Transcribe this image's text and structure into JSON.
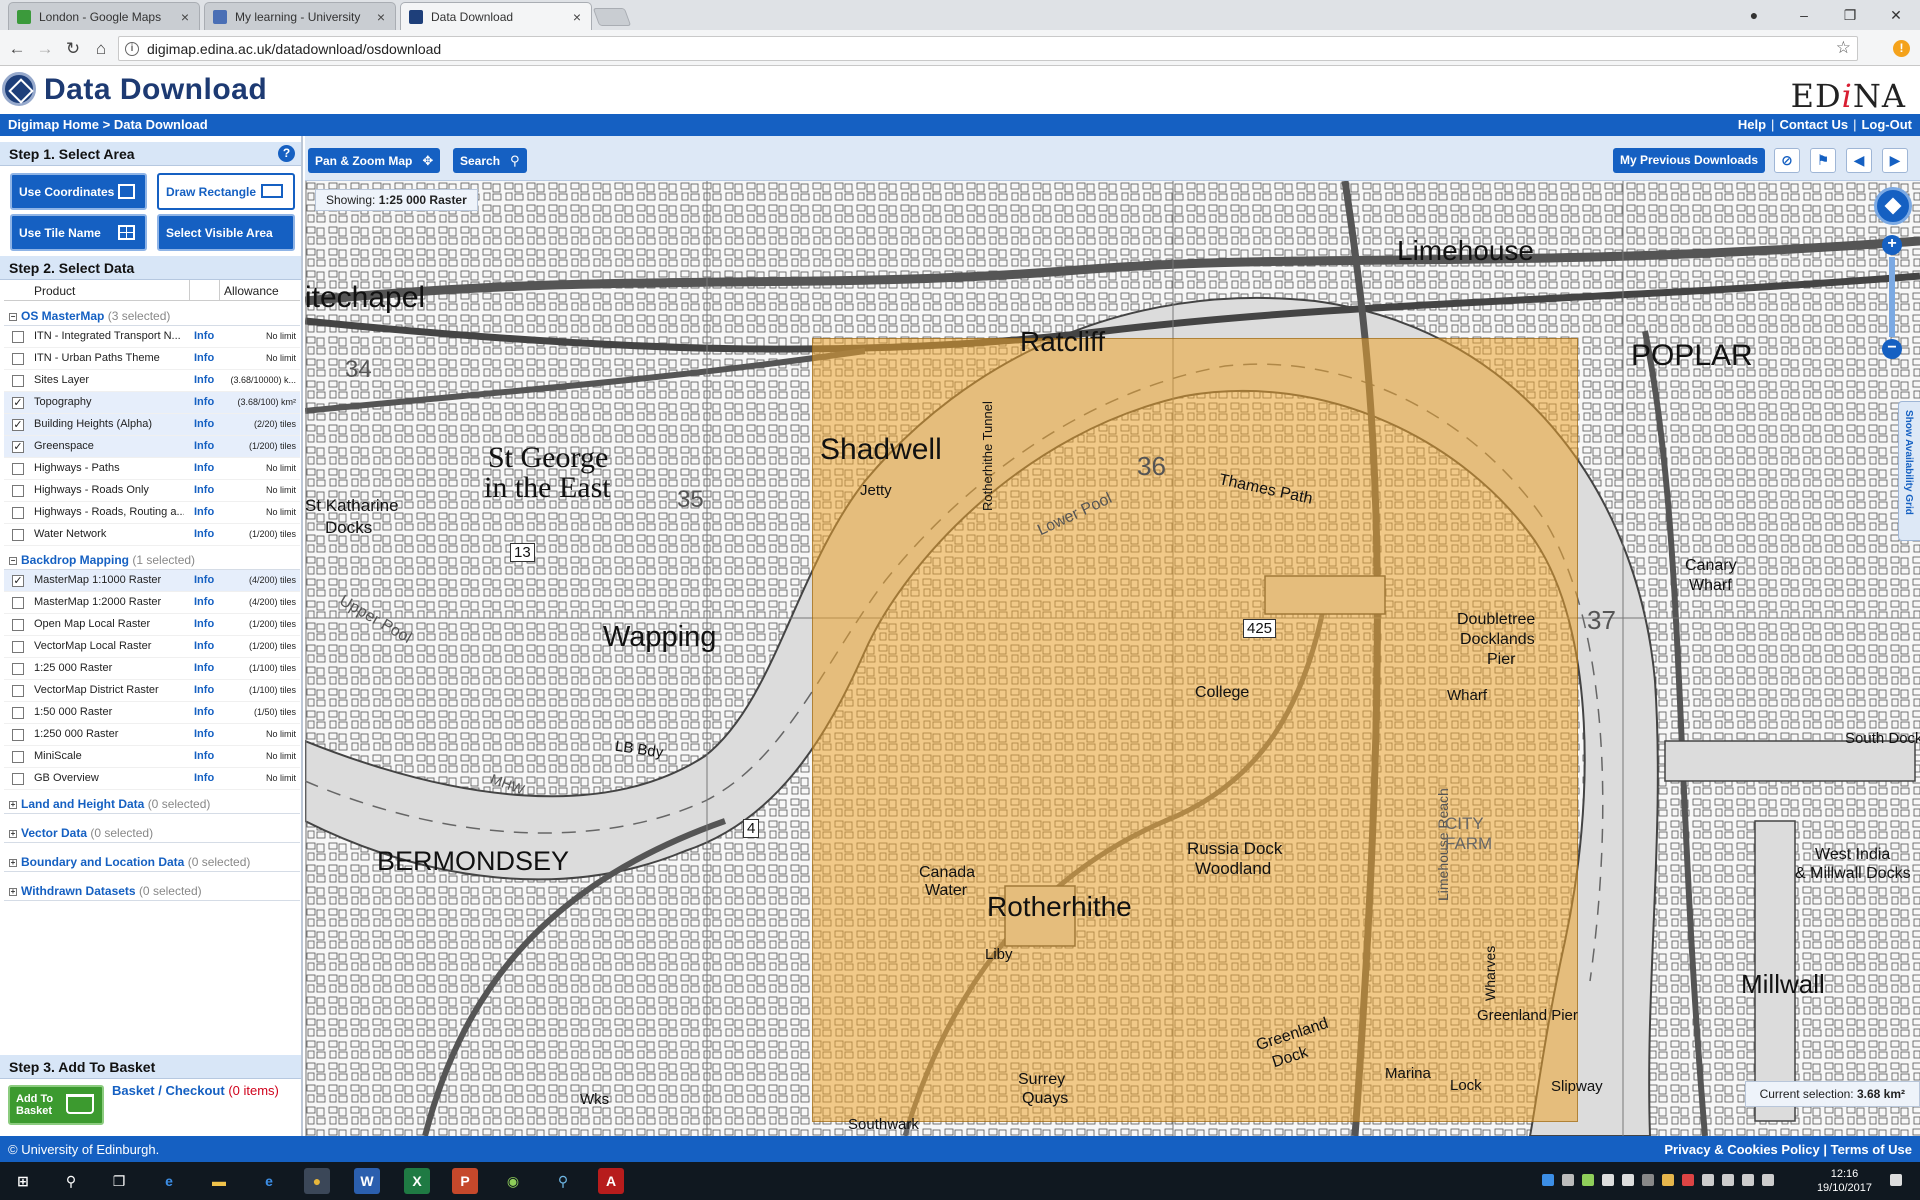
{
  "browser": {
    "tabs": [
      {
        "title": "London - Google Maps",
        "favicon_color": "#3b9a3b"
      },
      {
        "title": "My learning - University",
        "favicon_color": "#4a6fb5"
      },
      {
        "title": "Data Download",
        "favicon_color": "#1e3f7a"
      }
    ],
    "active_tab": 2,
    "url": "digimap.edina.ac.uk/datadownload/osdownload"
  },
  "header": {
    "title": "Data Download",
    "edina_prefix": "ED",
    "edina_i": "i",
    "edina_suffix": "NA"
  },
  "breadcrumb": "Digimap Home > Data Download",
  "topnav": {
    "help": "Help",
    "contact": "Contact Us",
    "logout": "Log-Out",
    "sep": "|"
  },
  "step1": {
    "title": "Step 1. Select Area",
    "help": "?",
    "buttons": {
      "use_coordinates": "Use Coordinates",
      "draw_rectangle": "Draw Rectangle",
      "use_tile_name": "Use Tile Name",
      "select_visible_area": "Select Visible Area"
    },
    "selected_button": "draw_rectangle"
  },
  "step2": {
    "title": "Step 2. Select Data",
    "col_product": "Product",
    "col_allowance": "Allowance",
    "info_label": "Info",
    "groups": [
      {
        "name": "OS MasterMap",
        "count": "(3 selected)",
        "expanded": true,
        "products": [
          {
            "name": "ITN - Integrated Transport N...",
            "allowance": "No limit",
            "checked": false
          },
          {
            "name": "ITN - Urban Paths Theme",
            "allowance": "No limit",
            "checked": false
          },
          {
            "name": "Sites Layer",
            "allowance": "(3.68/10000) k...",
            "checked": false
          },
          {
            "name": "Topography",
            "allowance": "(3.68/100) km²",
            "checked": true
          },
          {
            "name": "Building Heights (Alpha)",
            "allowance": "(2/20) tiles",
            "checked": true
          },
          {
            "name": "Greenspace",
            "allowance": "(1/200) tiles",
            "checked": true
          },
          {
            "name": "Highways - Paths",
            "allowance": "No limit",
            "checked": false
          },
          {
            "name": "Highways - Roads Only",
            "allowance": "No limit",
            "checked": false
          },
          {
            "name": "Highways - Roads, Routing a...",
            "allowance": "No limit",
            "checked": false
          },
          {
            "name": "Water Network",
            "allowance": "(1/200) tiles",
            "checked": false
          }
        ]
      },
      {
        "name": "Backdrop Mapping",
        "count": "(1 selected)",
        "expanded": true,
        "products": [
          {
            "name": "MasterMap 1:1000 Raster",
            "allowance": "(4/200) tiles",
            "checked": true
          },
          {
            "name": "MasterMap 1:2000 Raster",
            "allowance": "(4/200) tiles",
            "checked": false
          },
          {
            "name": "Open Map Local Raster",
            "allowance": "(1/200) tiles",
            "checked": false
          },
          {
            "name": "VectorMap Local Raster",
            "allowance": "(1/200) tiles",
            "checked": false
          },
          {
            "name": "1:25 000 Raster",
            "allowance": "(1/100) tiles",
            "checked": false
          },
          {
            "name": "VectorMap District Raster",
            "allowance": "(1/100) tiles",
            "checked": false
          },
          {
            "name": "1:50 000 Raster",
            "allowance": "(1/50) tiles",
            "checked": false
          },
          {
            "name": "1:250 000 Raster",
            "allowance": "No limit",
            "checked": false
          },
          {
            "name": "MiniScale",
            "allowance": "No limit",
            "checked": false
          },
          {
            "name": "GB Overview",
            "allowance": "No limit",
            "checked": false
          }
        ]
      },
      {
        "name": "Land and Height Data",
        "count": "(0 selected)",
        "expanded": false,
        "products": []
      },
      {
        "name": "Vector Data",
        "count": "(0 selected)",
        "expanded": false,
        "products": []
      },
      {
        "name": "Boundary and Location Data",
        "count": "(0 selected)",
        "expanded": false,
        "products": []
      },
      {
        "name": "Withdrawn Datasets",
        "count": "(0 selected)",
        "expanded": false,
        "products": []
      }
    ]
  },
  "step3": {
    "title": "Step 3. Add To Basket",
    "add_label_1": "Add To",
    "add_label_2": "Basket",
    "basket_link": "Basket / Checkout",
    "basket_items": "(0 items)"
  },
  "toolbar": {
    "pan_zoom": "Pan & Zoom Map",
    "search": "Search",
    "previous_downloads": "My Previous Downloads"
  },
  "map": {
    "showing_label": "Showing:",
    "showing_value": "1:25 000 Raster",
    "current_selection_label": "Current selection:",
    "current_selection_value": "3.68 km²",
    "availability_tab": "Show Availability Grid",
    "selection_color": "#eca42d",
    "place_labels": [
      "itechapel",
      "Ratcliff",
      "Limehouse",
      "POPLAR",
      "Shadwell",
      "St George",
      "in the East",
      "St Katharine",
      "Docks",
      "Wapping",
      "Rotherhithe",
      "BERMONDSEY",
      "Millwall",
      "Canary",
      "Wharf",
      "Russia Dock",
      "Woodland",
      "Canada",
      "Water",
      "College",
      "Greenland",
      "Dock",
      "Surrey",
      "Quays",
      "Thames Path",
      "Lower Pool",
      "Upper Pool",
      "Limehouse Reach",
      "CITY",
      "FARM",
      "Doubletree",
      "Docklands",
      "Pier",
      "West India",
      "& Millwall Docks",
      "South Dock",
      "LB Bdy",
      "MHW",
      "Jetty",
      "Wharf",
      "Slipway",
      "Lock",
      "Marina",
      "Liby",
      "Southwark",
      "Wks",
      "34",
      "35",
      "36",
      "37",
      "425",
      "13",
      "4",
      "Rotherhithe Tunnel",
      "Wharves",
      "Greenland Pier"
    ]
  },
  "footer": {
    "copyright": "© University of Edinburgh.",
    "privacy": "Privacy & Cookies Policy",
    "terms": "Terms of Use",
    "sep": "|"
  },
  "taskbar": {
    "time": "12:16",
    "date": "19/10/2017"
  },
  "colors": {
    "brand_blue": "#1560c2",
    "panel_header": "#d8e6f7",
    "basket_green": "#3c9a2f",
    "warning_red": "#d0021b"
  }
}
